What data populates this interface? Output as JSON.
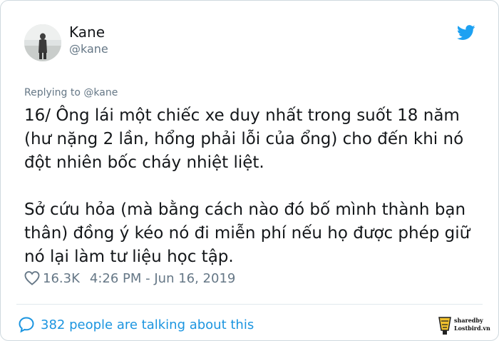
{
  "author": {
    "display_name": "Kane",
    "handle": "@kane",
    "avatar_icon": "avatar-photo"
  },
  "brand": {
    "icon": "twitter-bird-icon",
    "color": "#1da1f2"
  },
  "reply_context": "Replying to @kane",
  "tweet": {
    "paragraph1": "16/ Ông lái một chiếc xe duy nhất trong suốt 18 năm (hư nặng 2 lần, hổng phải lỗi của ổng) cho đến khi nó đột nhiên bốc cháy nhiệt liệt.",
    "paragraph2": "Sở cứu hỏa (mà bằng cách nào đó bố mình thành bạn thân) đồng ý kéo nó đi miễn phí nếu họ được phép giữ nó lại làm tư liệu học tập."
  },
  "meta": {
    "like_icon": "heart-icon",
    "like_count": "16.3K",
    "timestamp": "4:26 PM - Jun 16, 2019"
  },
  "footer": {
    "talking_icon": "speech-bubble-icon",
    "talking_text": "382 people are talking about this",
    "link_color": "#1b95e0"
  },
  "watermark": {
    "line1": "sharedby",
    "line2": "Lostbird.vn"
  }
}
